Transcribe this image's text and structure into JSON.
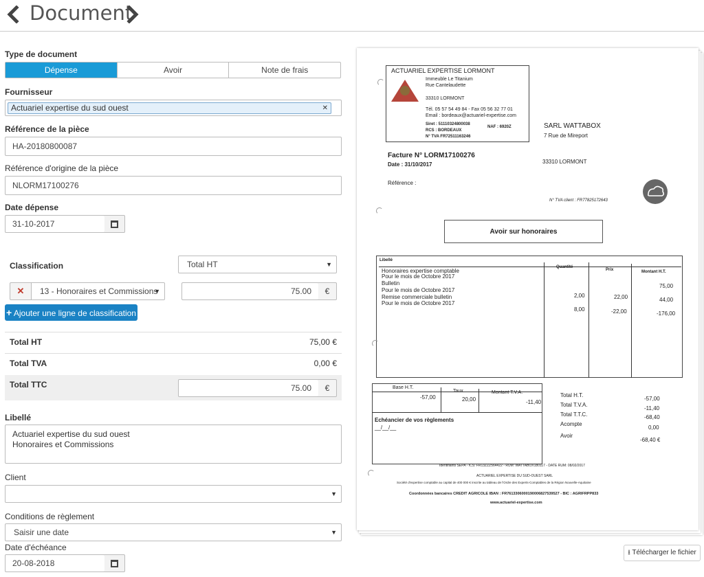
{
  "header": {
    "title": "Document"
  },
  "form": {
    "type_label": "Type de document",
    "type_options": [
      "Dépense",
      "Avoir",
      "Note de frais"
    ],
    "supplier_label": "Fournisseur",
    "supplier_value": "Actuariel expertise du sud ouest",
    "reference_label": "Référence de la pièce",
    "reference_value": "HA-20180800087",
    "origin_label": "Référence d'origine de la pièce",
    "origin_value": "NLORM17100276",
    "date_label": "Date dépense",
    "date_value": "31-10-2017",
    "classification_label": "Classification",
    "classification_mode": "Total HT",
    "classification_line": {
      "category": "13 - Honoraires et Commissions",
      "amount": "75.00",
      "currency": "€"
    },
    "add_line_label": "Ajouter une ligne de classification",
    "totals": [
      {
        "label": "Total HT",
        "value": "75,00 €"
      },
      {
        "label": "Total TVA",
        "value": "0,00 €"
      }
    ],
    "ttc_label": "Total TTC",
    "ttc_value": "75.00",
    "ttc_currency": "€",
    "libelle_label": "Libellé",
    "libelle_lines": [
      "Actuariel expertise du sud ouest",
      "Honoraires et Commissions"
    ],
    "client_label": "Client",
    "client_value": "",
    "payment_label": "Conditions de règlement",
    "payment_value": "Saisir une date",
    "due_label": "Date d'échéance",
    "due_value": "20-08-2018"
  },
  "download_label": "Télécharger le fichier",
  "invoice": {
    "company": "ACTUARIEL EXPERTISE LORMONT",
    "addr1": "Immeuble Le Titanium",
    "addr2": "Rue Cantelaudette",
    "addr3": "33310 LORMONT",
    "tel": "Tél.  05 57 54 49 84   - Fax  05 56 32 77 01",
    "email": "Email : bordeaux@actuariel-expertise.com",
    "siret": "Siret :  51110324800038",
    "naf": "NAF : 6920Z",
    "rcs": "RCS :  BORDEAUX",
    "tva": "N° TVA FR72511163246",
    "client_name": "SARL WATTABOX",
    "client_addr1": "7 Rue de Mireport",
    "client_addr2": "33310 LORMONT",
    "invoice_no": "Facture N° LORM17100276",
    "invoice_date": "Date : 31/10/2017",
    "reference": "Référence :",
    "tva_client": "N° TVA client : FR77825172643",
    "doc_title": "Avoir sur honoraires",
    "col_libelle": "Libellé",
    "col_qty": "Quantité",
    "col_price": "Prix",
    "col_amount": "Montant H.T.",
    "items": [
      {
        "text": "Honoraires expertise comptable",
        "qty": "",
        "price": "",
        "amount": ""
      },
      {
        "text": "Pour le mois de Octobre 2017",
        "qty": "",
        "price": "",
        "amount": "75,00"
      },
      {
        "text": "Bulletin",
        "qty": "",
        "price": "",
        "amount": ""
      },
      {
        "text": " Pour le mois de Octobre 2017",
        "qty": "2,00",
        "price": "22,00",
        "amount": "44,00"
      },
      {
        "text": "Remise commerciale bulletin",
        "qty": "",
        "price": "",
        "amount": ""
      },
      {
        "text": " Pour le mois de Octobre 2017",
        "qty": "8,00",
        "price": "-22,00",
        "amount": "-176,00"
      }
    ],
    "vat_headers": [
      "Base H.T.",
      "Taux",
      "Montant T.V.A."
    ],
    "vat_values": [
      "-57,00",
      "20,00",
      "-11,40"
    ],
    "schedule_title": "Echéancier de vos règlements",
    "schedule_value": "__/__/__",
    "total_labels": [
      "Total H.T.",
      "Total T.V.A.",
      "Total T.T.C.",
      "Acompte",
      "Avoir"
    ],
    "total_values": [
      "-57,00",
      "-11,40",
      "-68,40",
      "0,00",
      "-68,40  €"
    ],
    "sepa": "Identifiants SEPA - ICS: FR13ZZZ564422 - RUM: WATTABOX180117 - DATE RUM: 08/02/2017",
    "footer1": "ACTUARIEL EXPERTISE DU SUD-OUEST SARL",
    "footer2": "Société d'expertise comptable au capital de 400 000 € inscrite au tableau de l'Ordre des Experts-Comptables de la Région Nouvelle-Aquitaine",
    "footer3": "Coordonnées bancaires CREDIT AGRICOLE IBAN : FR7613306000190006827539527  -  BIC : AGRIFRPP833",
    "footer4": "www.actuariel-expertise.com"
  },
  "colors": {
    "accent": "#1a9bd7",
    "button": "#1a82c4",
    "remove": "#c0392b"
  }
}
